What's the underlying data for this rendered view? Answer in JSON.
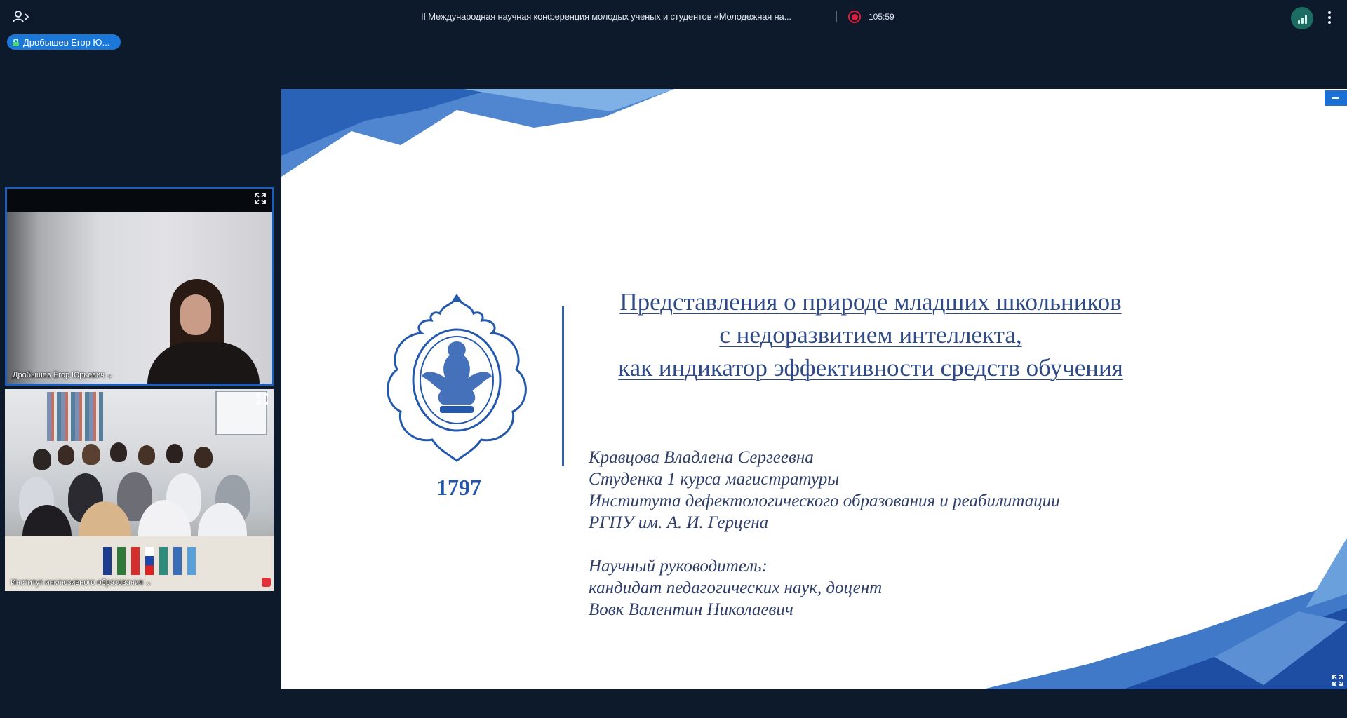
{
  "header": {
    "meeting_title": "II Международная научная конференция молодых ученых и студентов «Молодежная на...",
    "recording_timer": "105:59"
  },
  "speaker": {
    "badge_label": "Дробышев Егор Ю..."
  },
  "tiles": [
    {
      "name": "Дробышев Егор Юрьевич ⌄"
    },
    {
      "name": "Институт инклюзивного образования ⌄"
    }
  ],
  "slide": {
    "title_lines": [
      "Представления о природе младших школьников",
      "с недоразвитием интеллекта,",
      "как индикатор эффективности средств обучения"
    ],
    "year": "1797",
    "author_lines": [
      "Кравцова Владлена Сергеевна",
      "Студенка 1 курса магистратуры",
      "Института дефектологического образования и реабилитации",
      "РГПУ им. А. И. Герцена"
    ],
    "supervisor_lines": [
      "Научный руководитель:",
      "кандидат педагогических наук, доцент",
      "Вовк Валентин Николаевич"
    ]
  },
  "colors": {
    "background": "#0c1a2c",
    "accent": "#1b78d8",
    "record": "#e01e3c",
    "slide_text": "#2f4a86"
  },
  "icons": [
    "participants-icon",
    "record-icon",
    "signal-icon",
    "more-icon",
    "lock-icon",
    "expand-icon",
    "minimize-icon"
  ]
}
